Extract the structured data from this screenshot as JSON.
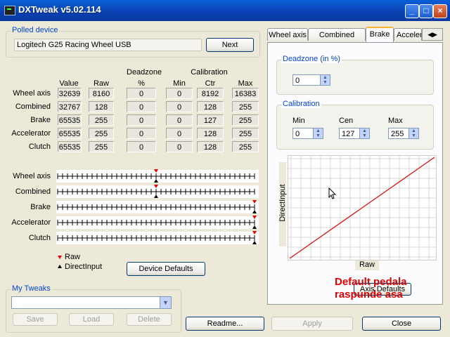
{
  "window": {
    "title": "DXTweak v5.02.114",
    "controls": [
      "_",
      "□",
      "×"
    ]
  },
  "polled_device": {
    "label": "Polled device",
    "device": "Logitech G25 Racing Wheel USB",
    "next_label": "Next"
  },
  "table": {
    "group_headers": {
      "deadzone": "Deadzone",
      "calibration": "Calibration"
    },
    "columns": [
      "Value",
      "Raw",
      "%",
      "Min",
      "Ctr",
      "Max"
    ],
    "rows": [
      {
        "name": "Wheel axis",
        "cells": [
          "32639",
          "8160",
          "0",
          "0",
          "8192",
          "16383"
        ]
      },
      {
        "name": "Combined",
        "cells": [
          "32767",
          "128",
          "0",
          "0",
          "128",
          "255"
        ]
      },
      {
        "name": "Brake",
        "cells": [
          "65535",
          "255",
          "0",
          "0",
          "127",
          "255"
        ]
      },
      {
        "name": "Accelerator",
        "cells": [
          "65535",
          "255",
          "0",
          "0",
          "128",
          "255"
        ]
      },
      {
        "name": "Clutch",
        "cells": [
          "65535",
          "255",
          "0",
          "0",
          "128",
          "255"
        ]
      }
    ]
  },
  "axes": [
    {
      "name": "Wheel axis",
      "raw": 0.5,
      "directinput": 0.5
    },
    {
      "name": "Combined",
      "raw": 0.5,
      "directinput": 0.5
    },
    {
      "name": "Brake",
      "raw": 1.0,
      "directinput": 1.0
    },
    {
      "name": "Accelerator",
      "raw": 1.0,
      "directinput": 1.0
    },
    {
      "name": "Clutch",
      "raw": 1.0,
      "directinput": 1.0
    }
  ],
  "legend": {
    "raw": "Raw",
    "directinput": "DirectInput"
  },
  "device_defaults_label": "Device Defaults",
  "my_tweaks": {
    "label": "My Tweaks",
    "selected": "",
    "save": "Save",
    "load": "Load",
    "delete": "Delete"
  },
  "tabs": [
    "Wheel axis",
    "Combined pedals",
    "Brake",
    "Acceler"
  ],
  "active_tab": "Brake",
  "deadzone": {
    "label": "Deadzone (in %)",
    "value": "0"
  },
  "calibration": {
    "label": "Calibration",
    "min_label": "Min",
    "cen_label": "Cen",
    "max_label": "Max",
    "min": "0",
    "cen": "127",
    "max": "255"
  },
  "graph": {
    "ylabel": "DirectInput",
    "xlabel": "Raw",
    "line_color": "#e01010"
  },
  "axis_defaults_label": "Axis Defaults",
  "annotation": {
    "line1": "Default pedala",
    "line2": "raspunde asa",
    "color": "#e00000"
  },
  "bottom_buttons": {
    "readme": "Readme...",
    "apply": "Apply",
    "close": "Close"
  }
}
